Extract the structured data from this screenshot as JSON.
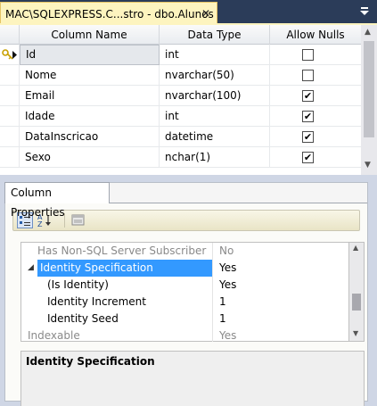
{
  "tab": {
    "title": "MAC\\SQLEXPRESS.C...stro - dbo.Alunos",
    "close_glyph": "✕"
  },
  "designer": {
    "headers": {
      "name": "Column Name",
      "type": "Data Type",
      "nulls": "Allow Nulls"
    },
    "rows": [
      {
        "name": "Id",
        "type": "int",
        "allow_nulls": false,
        "primary_key": true
      },
      {
        "name": "Nome",
        "type": "nvarchar(50)",
        "allow_nulls": false
      },
      {
        "name": "Email",
        "type": "nvarchar(100)",
        "allow_nulls": true
      },
      {
        "name": "Idade",
        "type": "int",
        "allow_nulls": true
      },
      {
        "name": "DataInscricao",
        "type": "datetime",
        "allow_nulls": true
      },
      {
        "name": "Sexo",
        "type": "nchar(1)",
        "allow_nulls": true
      }
    ],
    "check_glyph": "✔"
  },
  "properties": {
    "tab_label": "Column Properties",
    "rows": [
      {
        "label": "Has Non-SQL Server Subscriber",
        "value": "No"
      },
      {
        "label": "Identity Specification",
        "value": "Yes"
      },
      {
        "label": "(Is Identity)",
        "value": "Yes"
      },
      {
        "label": "Identity Increment",
        "value": "1"
      },
      {
        "label": "Identity Seed",
        "value": "1"
      },
      {
        "label": "Indexable",
        "value": "Yes"
      }
    ],
    "description_title": "Identity Specification"
  },
  "colors": {
    "background": "#2b3c59",
    "tab": "#fdf4bf",
    "selection": "#3399ff"
  }
}
